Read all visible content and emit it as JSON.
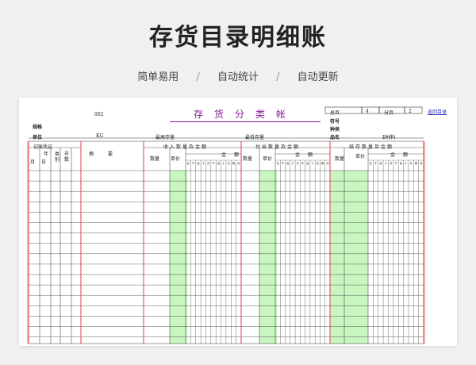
{
  "page": {
    "title": "存货目录明细账",
    "tags": [
      "简单易用",
      "自动统计",
      "自动更新"
    ],
    "separator": "/"
  },
  "ledger": {
    "code": "002",
    "title": "存货分类帐",
    "total_page_label": "总页",
    "total_page_value": "4",
    "sub_page_label": "分页",
    "sub_page_value": "2",
    "back_link": "返回目录",
    "spec_label": "规格",
    "symbol_label": "符号",
    "category_label": "种类",
    "unit_label": "单位",
    "unit_value": "KG",
    "max_stock_label": "最高存量",
    "min_stock_label": "最低存量",
    "product_label": "品名",
    "product_value": "B材料",
    "voucher_header": "记账凭证",
    "year_label": "年",
    "month_label": "月",
    "day_label": "日",
    "type_label": "类别",
    "no_label": "号数",
    "summary_label": "摘要",
    "in_header": "收入数量及金额",
    "out_header": "付出数量及金额",
    "balance_header": "结存数量及金额",
    "qty_label": "数量",
    "price_label": "单价",
    "amount_label": "金额",
    "digit_labels": [
      "亿",
      "千",
      "百",
      "十",
      "万",
      "千",
      "百",
      "十",
      "元",
      "角",
      "分"
    ]
  },
  "colors": {
    "red_line": "#e0505a",
    "green_fill": "#c8f5c0",
    "purple": "#8a1a9a"
  }
}
